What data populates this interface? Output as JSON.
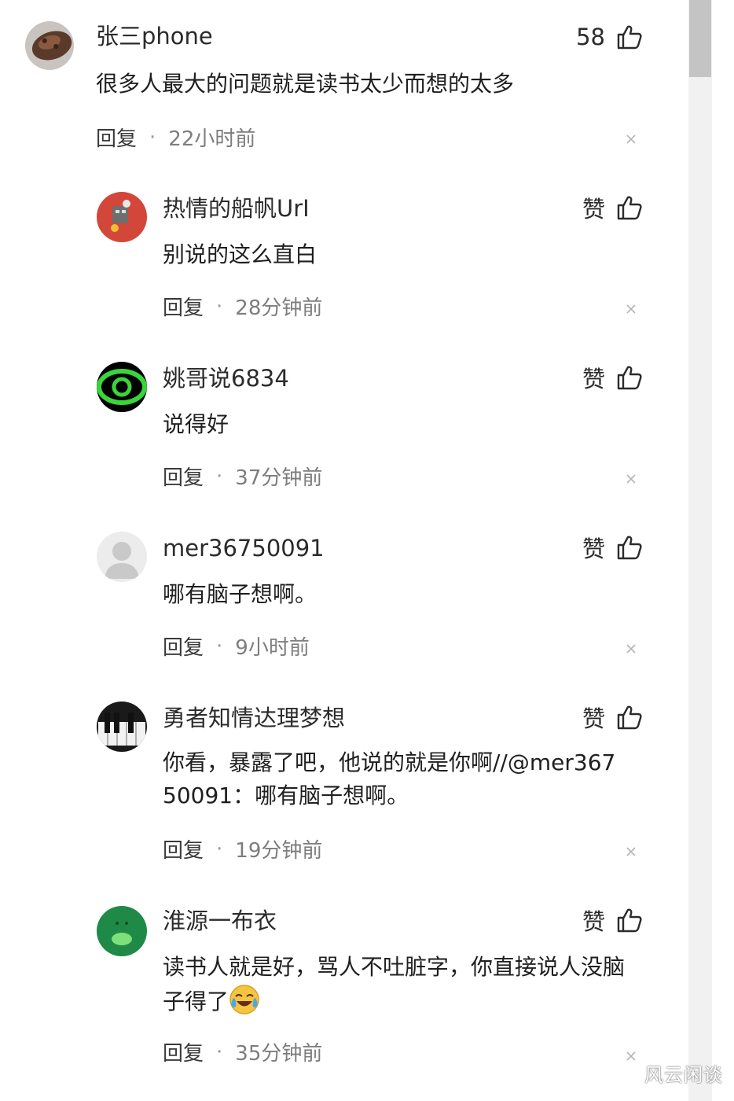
{
  "comments": [
    {
      "username": "张三phone",
      "like_label": "58",
      "content": "很多人最大的问题就是读书太少而想的太多",
      "reply_label": "回复",
      "time": "22小时前",
      "avatar_icon": "brown-pastry-avatar"
    },
    {
      "username": "热情的船帆UrI",
      "like_label": "赞",
      "content": "别说的这么直白",
      "reply_label": "回复",
      "time": "28分钟前",
      "avatar_icon": "red-robot-avatar"
    },
    {
      "username": "姚哥说6834",
      "like_label": "赞",
      "content": "说得好",
      "reply_label": "回复",
      "time": "37分钟前",
      "avatar_icon": "green-eye-avatar"
    },
    {
      "username": "mer36750091",
      "like_label": "赞",
      "content": "哪有脑子想啊。",
      "reply_label": "回复",
      "time": "9小时前",
      "avatar_icon": "default-grey-avatar"
    },
    {
      "username": "勇者知情达理梦想",
      "like_label": "赞",
      "content": "你看，暴露了吧，他说的就是你啊//@mer367\n50091：哪有脑子想啊。",
      "reply_label": "回复",
      "time": "19分钟前",
      "avatar_icon": "piano-keys-avatar"
    },
    {
      "username": "淮源一布衣",
      "like_label": "赞",
      "content": "读书人就是好，骂人不吐脏字，你直接说人没脑\n子得了",
      "reply_label": "回复",
      "time": "35分钟前",
      "avatar_icon": "green-frog-avatar",
      "trailing_emoji": "laugh-cry-emoji"
    }
  ],
  "dot_separator": "·",
  "watermark": "风云闲谈",
  "colors": {
    "text_primary": "#222222",
    "text_secondary": "#7d7d7d",
    "scrollbar_track": "#f1f1f1",
    "scrollbar_thumb": "#c4c4c4"
  }
}
